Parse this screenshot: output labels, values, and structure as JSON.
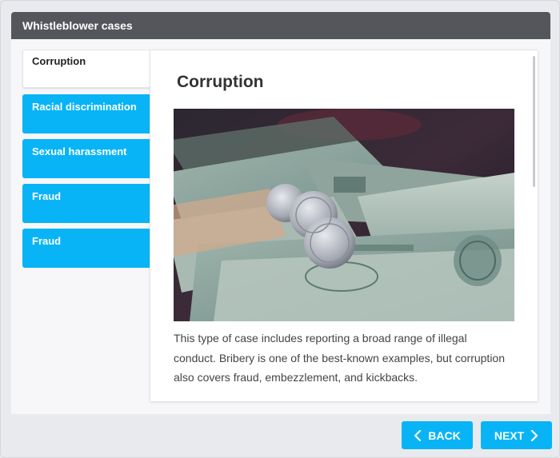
{
  "window": {
    "title": "Whistleblower cases"
  },
  "tabs": [
    {
      "label": "Corruption",
      "active": true
    },
    {
      "label": "Racial discrimination",
      "active": false
    },
    {
      "label": "Sexual harassment",
      "active": false
    },
    {
      "label": "Fraud",
      "active": false
    },
    {
      "label": "Fraud",
      "active": false
    }
  ],
  "panel": {
    "title": "Corruption",
    "image_icon": "money-coins-photo",
    "body": "This type of case includes reporting a broad range of illegal conduct. Bribery is one of the best-known examples, but corruption also covers fraud, embezzlement, and kickbacks."
  },
  "buttons": {
    "back": "BACK",
    "next": "NEXT"
  },
  "colors": {
    "accent": "#08b4f6",
    "titlebar": "#54565b",
    "background": "#e9eaee"
  }
}
